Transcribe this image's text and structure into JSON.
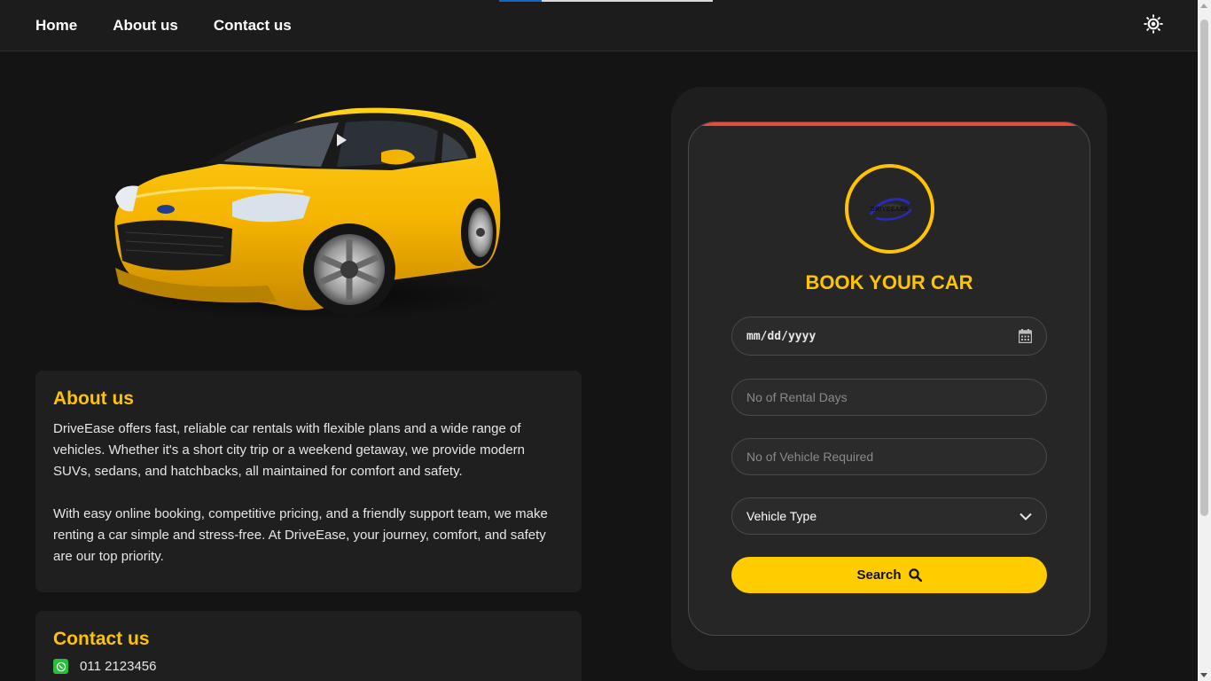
{
  "nav": {
    "items": [
      {
        "label": "Home"
      },
      {
        "label": "About us"
      },
      {
        "label": "Contact us"
      }
    ],
    "theme_toggle_icon": "sun-icon"
  },
  "page_load_progress": 0.2,
  "hero": {
    "image": "yellow-hatchback-car",
    "play_icon": "play-icon"
  },
  "about": {
    "title": "About us",
    "paragraph_1": "DriveEase offers fast, reliable car rentals with flexible plans and a wide range of vehicles. Whether it's a short city trip or a weekend getaway, we provide modern SUVs, sedans, and hatchbacks, all maintained for comfort and safety.",
    "paragraph_2": "With easy online booking, competitive pricing, and a friendly support team, we make renting a car simple and stress-free. At DriveEase, your journey, comfort, and safety are our top priority."
  },
  "contact": {
    "title": "Contact us",
    "phone_icon": "whatsapp-icon",
    "phone": "011 2123456"
  },
  "booking": {
    "logo_text": "DRIVEEASE",
    "title": "BOOK YOUR CAR",
    "date_value": "mm/dd/yyyy",
    "date_icon": "calendar-icon",
    "rental_days_placeholder": "No of Rental Days",
    "vehicles_placeholder": "No of Vehicle Required",
    "vehicle_type_selected": "Vehicle Type",
    "vehicle_type_icon": "chevron-down-icon",
    "search_label": "Search",
    "search_icon": "search-icon"
  },
  "colors": {
    "accent": "#ffc300",
    "button": "#ffcc00",
    "card_top_bar": "#e74c3c",
    "background": "#141414",
    "whatsapp": "#25c03a"
  }
}
